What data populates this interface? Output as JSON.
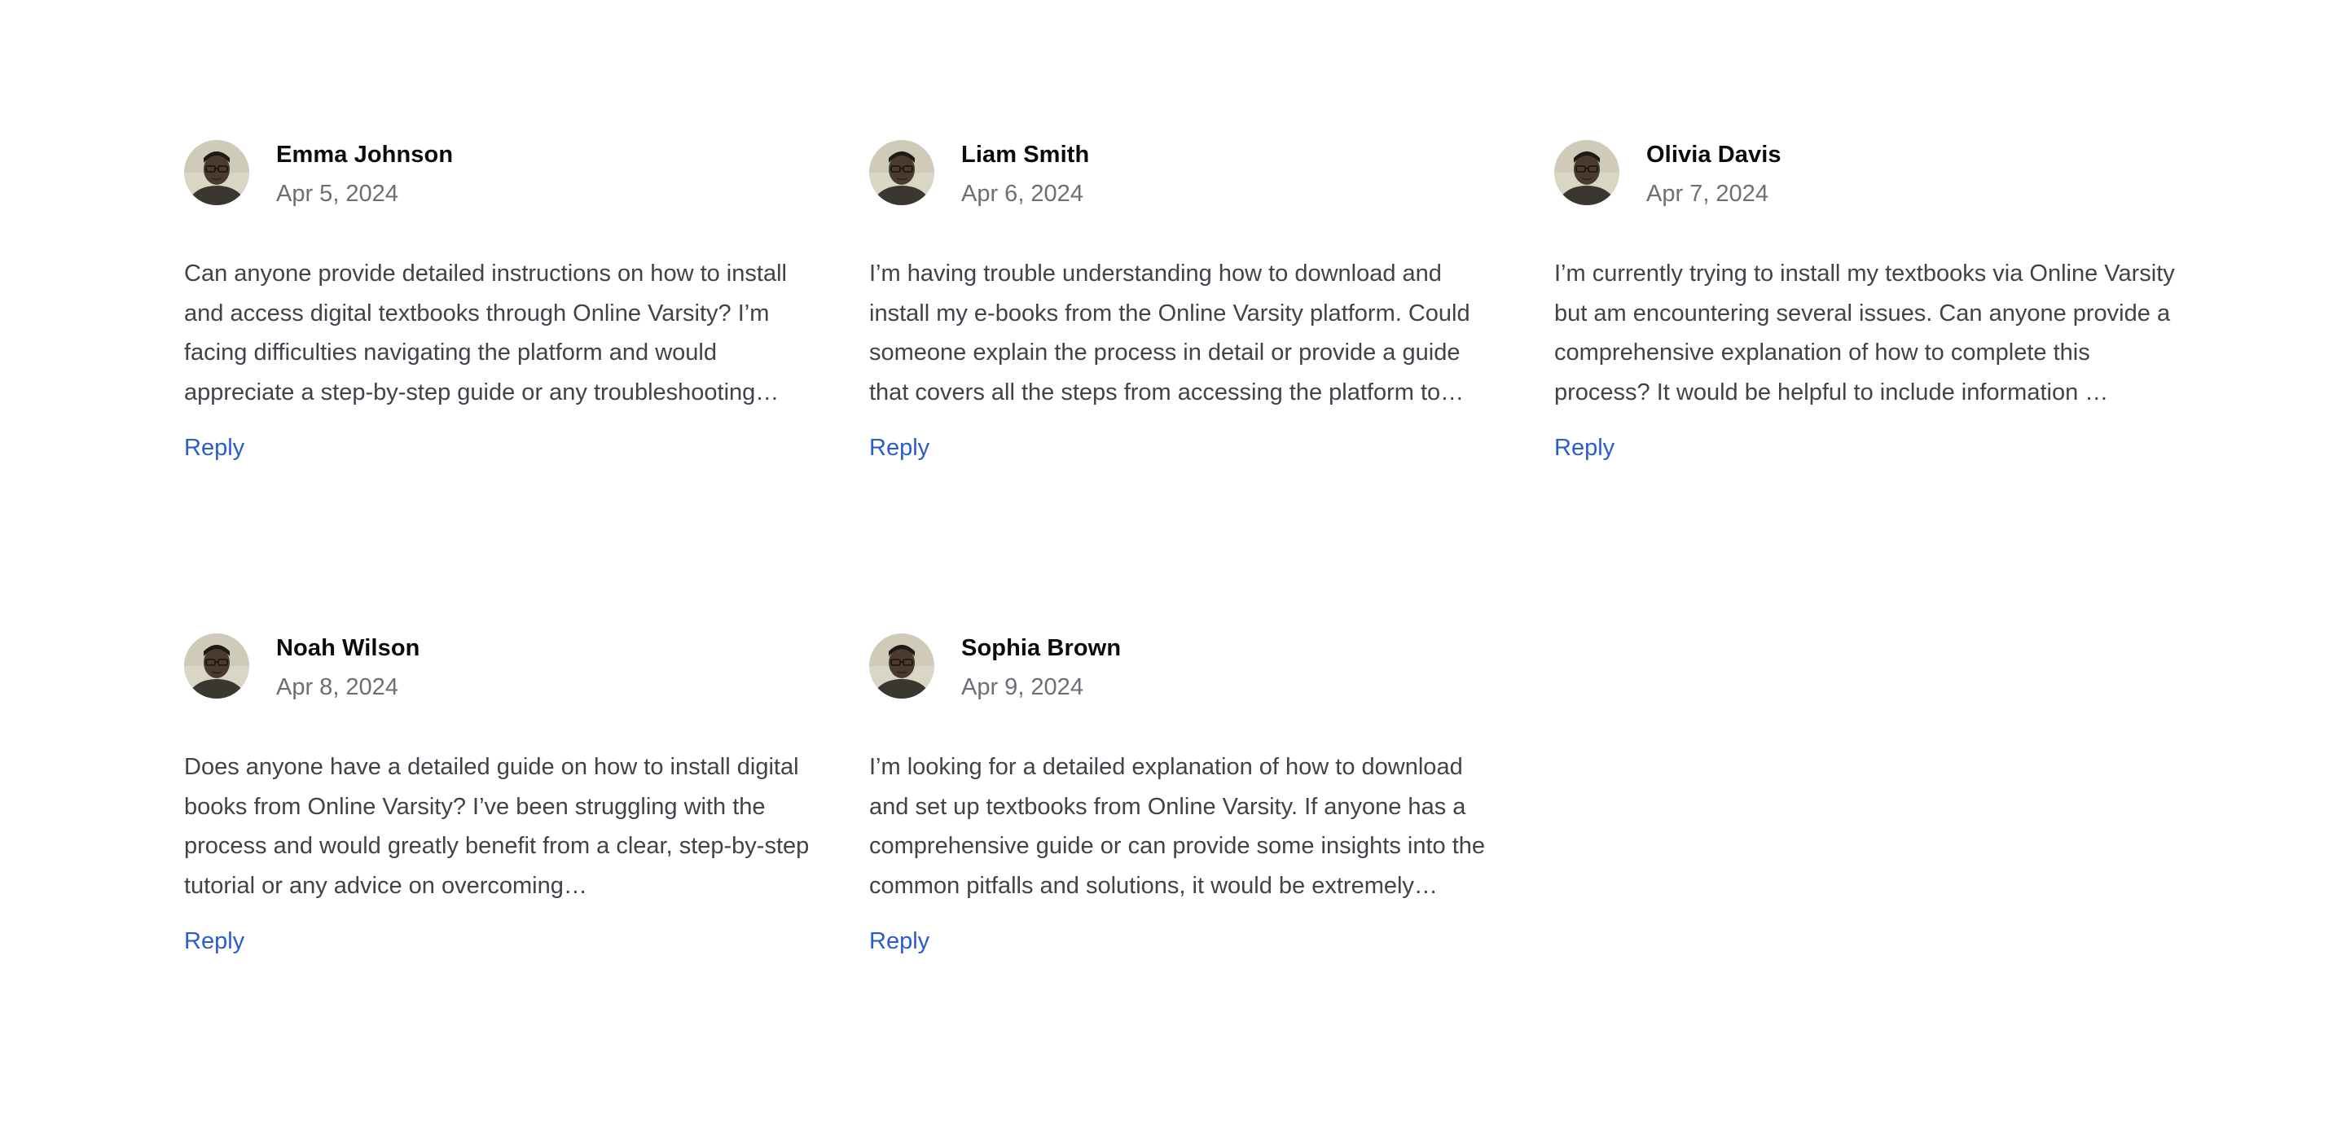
{
  "comments": [
    {
      "name": "Emma Johnson",
      "date": "Apr 5, 2024",
      "text": "Can anyone provide detailed instructions on how to install and access digital textbooks through Online Varsity? I’m facing difficulties navigating the platform and would appreciate a step-by-step guide or any troubleshooting…",
      "reply_label": "Reply",
      "avatar_icon": "user-avatar-photo"
    },
    {
      "name": "Liam Smith",
      "date": "Apr 6, 2024",
      "text": "I’m having trouble understanding how to download and install my e-books from the Online Varsity platform. Could someone explain the process in detail or provide a guide that covers all the steps from accessing the platform to…",
      "reply_label": "Reply",
      "avatar_icon": "user-avatar-photo"
    },
    {
      "name": "Olivia Davis",
      "date": "Apr 7, 2024",
      "text": "I’m currently trying to install my textbooks via Online Varsity but am encountering several issues. Can anyone provide a comprehensive explanation of how to complete this process? It would be helpful to include information …",
      "reply_label": "Reply",
      "avatar_icon": "user-avatar-photo"
    },
    {
      "name": "Noah Wilson",
      "date": "Apr 8, 2024",
      "text": "Does anyone have a detailed guide on how to install digital books from Online Varsity? I’ve been struggling with the process and would greatly benefit from a clear, step-by-step tutorial or any advice on overcoming…",
      "reply_label": "Reply",
      "avatar_icon": "user-avatar-photo"
    },
    {
      "name": "Sophia Brown",
      "date": "Apr 9, 2024",
      "text": "I’m looking for a detailed explanation of how to download and set up textbooks from Online Varsity. If anyone has a comprehensive guide or can provide some insights into the common pitfalls and solutions, it would be extremely…",
      "reply_label": "Reply",
      "avatar_icon": "user-avatar-photo"
    }
  ],
  "colors": {
    "name": "#0b0b0b",
    "date": "#6b6f76",
    "body": "#3f434a",
    "link": "#2b5cc9"
  }
}
